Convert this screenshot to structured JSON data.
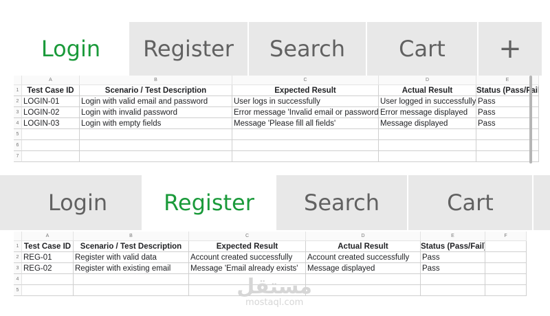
{
  "top_tabs": [
    "Login",
    "Register",
    "Search",
    "Cart"
  ],
  "top_active": "Login",
  "add_tab_symbol": "+",
  "bottom_tabs": [
    "Login",
    "Register",
    "Search",
    "Cart"
  ],
  "bottom_active": "Register",
  "colors": {
    "active_tab_text": "#1a9a3a",
    "inactive_tab_text": "#616161",
    "tab_bg": "#e8e8e8"
  },
  "login_sheet": {
    "col_letters": [
      "A",
      "B",
      "C",
      "D",
      "E"
    ],
    "header": [
      "Test Case ID",
      "Scenario / Test Description",
      "Expected Result",
      "Actual Result",
      "Status (Pass/Fail)"
    ],
    "rows": [
      [
        "LOGIN-01",
        "Login with valid email and password",
        "User logs in successfully",
        "User logged in successfully",
        "Pass"
      ],
      [
        "LOGIN-02",
        "Login with invalid password",
        "Error message 'Invalid email or password'",
        "Error message displayed",
        "Pass"
      ],
      [
        "LOGIN-03",
        "Login with empty fields",
        "Message 'Please fill all fields'",
        "Message displayed",
        "Pass"
      ],
      [
        "",
        "",
        "",
        "",
        ""
      ],
      [
        "",
        "",
        "",
        "",
        ""
      ],
      [
        "",
        "",
        "",
        "",
        ""
      ]
    ],
    "row_numbers": [
      "1",
      "2",
      "3",
      "4",
      "5",
      "6",
      "7"
    ]
  },
  "register_sheet": {
    "col_letters": [
      "A",
      "B",
      "C",
      "D",
      "E",
      "F"
    ],
    "header": [
      "Test Case ID",
      "Scenario / Test Description",
      "Expected Result",
      "Actual Result",
      "Status (Pass/Fail)",
      ""
    ],
    "rows": [
      [
        "REG-01",
        "Register with valid data",
        "Account created successfully",
        "Account created successfully",
        "Pass",
        ""
      ],
      [
        "REG-02",
        "Register with existing email",
        "Message 'Email already exists'",
        "Message displayed",
        "Pass",
        ""
      ],
      [
        "",
        "",
        "",
        "",
        "",
        ""
      ],
      [
        "",
        "",
        "",
        "",
        "",
        ""
      ]
    ],
    "row_numbers": [
      "1",
      "2",
      "3",
      "4",
      "5"
    ]
  },
  "watermark": {
    "arabic": "مستقل",
    "latin": "mostaql.com"
  }
}
